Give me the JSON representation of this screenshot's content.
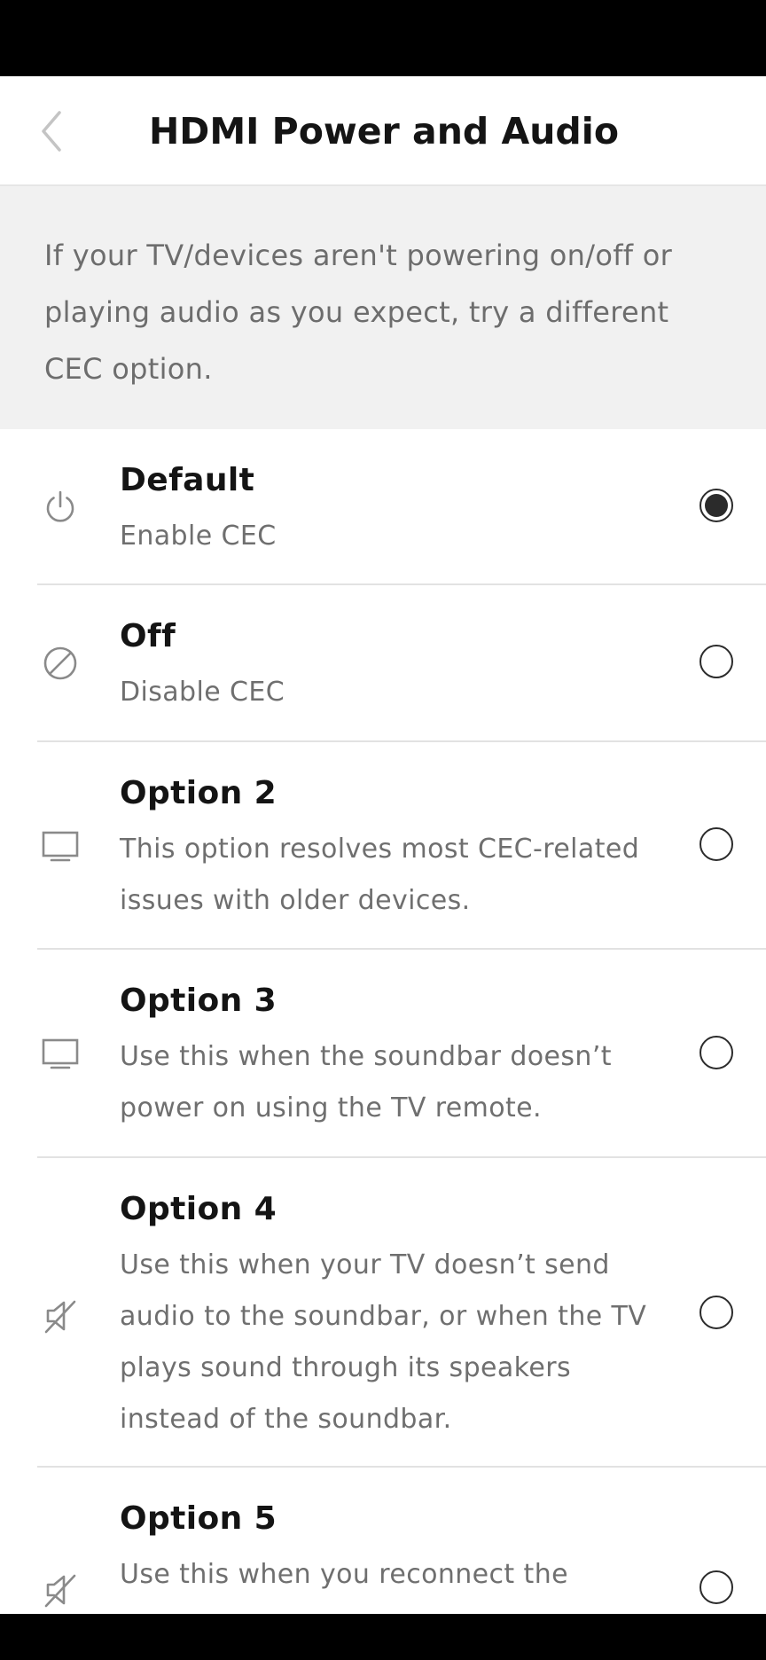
{
  "header": {
    "title": "HDMI Power and Audio",
    "back_icon": "chevron-left-icon"
  },
  "info": {
    "text": "If your TV/devices aren't powering on/off or playing audio as you expect, try a different CEC option."
  },
  "options": [
    {
      "icon": "power-icon",
      "title": "Default",
      "description": "Enable CEC",
      "selected": true
    },
    {
      "icon": "disabled-icon",
      "title": "Off",
      "description": "Disable CEC",
      "selected": false
    },
    {
      "icon": "tv-icon",
      "title": "Option 2",
      "description": "This option resolves most CEC-related issues with older devices.",
      "selected": false
    },
    {
      "icon": "tv-icon",
      "title": "Option 3",
      "description": "Use this when the soundbar doesn’t power on using the TV remote.",
      "selected": false
    },
    {
      "icon": "speaker-muted-icon",
      "title": "Option 4",
      "description": "Use this when your TV doesn’t send audio to the soundbar, or when the TV plays sound through its speakers instead of the soundbar.",
      "selected": false
    },
    {
      "icon": "speaker-muted-icon",
      "title": "Option 5",
      "description": "Use this when you reconnect the",
      "selected": false
    }
  ],
  "colors": {
    "accent": "#2b2b2b",
    "banner_bg": "#f1f1f1",
    "secondary_text": "#6f6f6f"
  }
}
